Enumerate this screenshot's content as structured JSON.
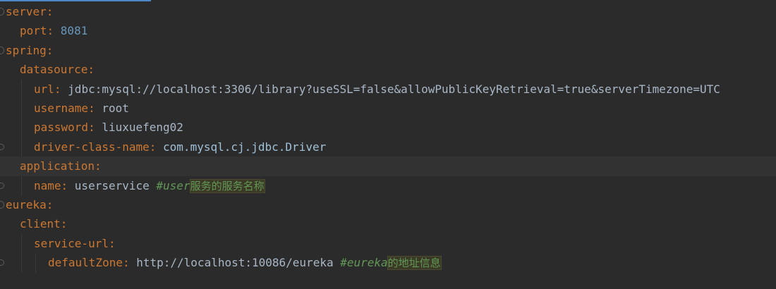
{
  "editor": {
    "language": "yaml",
    "current_line_index": 8,
    "lines": [
      {
        "indent": 0,
        "fold": "start",
        "key": "server",
        "sep": ":",
        "value": "",
        "value_type": "none",
        "comment": "",
        "comment_cjk": ""
      },
      {
        "indent": 1,
        "fold": "",
        "key": "port",
        "sep": ": ",
        "value": "8081",
        "value_type": "number",
        "comment": "",
        "comment_cjk": ""
      },
      {
        "indent": 0,
        "fold": "start",
        "key": "spring",
        "sep": ":",
        "value": "",
        "value_type": "none",
        "comment": "",
        "comment_cjk": ""
      },
      {
        "indent": 1,
        "fold": "",
        "key": "datasource",
        "sep": ":",
        "value": "",
        "value_type": "none",
        "comment": "",
        "comment_cjk": ""
      },
      {
        "indent": 2,
        "fold": "",
        "key": "url",
        "sep": ": ",
        "value": "jdbc:mysql://localhost:3306/library?useSSL=false&allowPublicKeyRetrieval=true&serverTimezone=UTC",
        "value_type": "string",
        "comment": "",
        "comment_cjk": ""
      },
      {
        "indent": 2,
        "fold": "",
        "key": "username",
        "sep": ": ",
        "value": "root",
        "value_type": "string",
        "comment": "",
        "comment_cjk": ""
      },
      {
        "indent": 2,
        "fold": "",
        "key": "password",
        "sep": ": ",
        "value": "liuxuefeng02",
        "value_type": "string",
        "comment": "",
        "comment_cjk": ""
      },
      {
        "indent": 2,
        "fold": "end",
        "key": "driver-class-name",
        "sep": ": ",
        "value": "com.mysql.cj.jdbc.Driver",
        "value_type": "class",
        "comment": "",
        "comment_cjk": ""
      },
      {
        "indent": 1,
        "fold": "",
        "key": "application",
        "sep": ":",
        "value": "",
        "value_type": "none",
        "comment": "",
        "comment_cjk": ""
      },
      {
        "indent": 2,
        "fold": "end",
        "key": "name",
        "sep": ": ",
        "value": "userservice",
        "value_type": "string",
        "comment": "#user",
        "comment_cjk": "服务的服务名称"
      },
      {
        "indent": 0,
        "fold": "start",
        "key": "eureka",
        "sep": ":",
        "value": "",
        "value_type": "none",
        "comment": "",
        "comment_cjk": ""
      },
      {
        "indent": 1,
        "fold": "",
        "key": "client",
        "sep": ":",
        "value": "",
        "value_type": "none",
        "comment": "",
        "comment_cjk": ""
      },
      {
        "indent": 2,
        "fold": "",
        "key": "service-url",
        "sep": ":",
        "value": "",
        "value_type": "none",
        "comment": "",
        "comment_cjk": ""
      },
      {
        "indent": 3,
        "fold": "end",
        "key": "defaultZone",
        "sep": ": ",
        "value": "http://localhost:10086/eureka",
        "value_type": "string",
        "comment": "#eureka",
        "comment_cjk": "的地址信息"
      }
    ]
  }
}
